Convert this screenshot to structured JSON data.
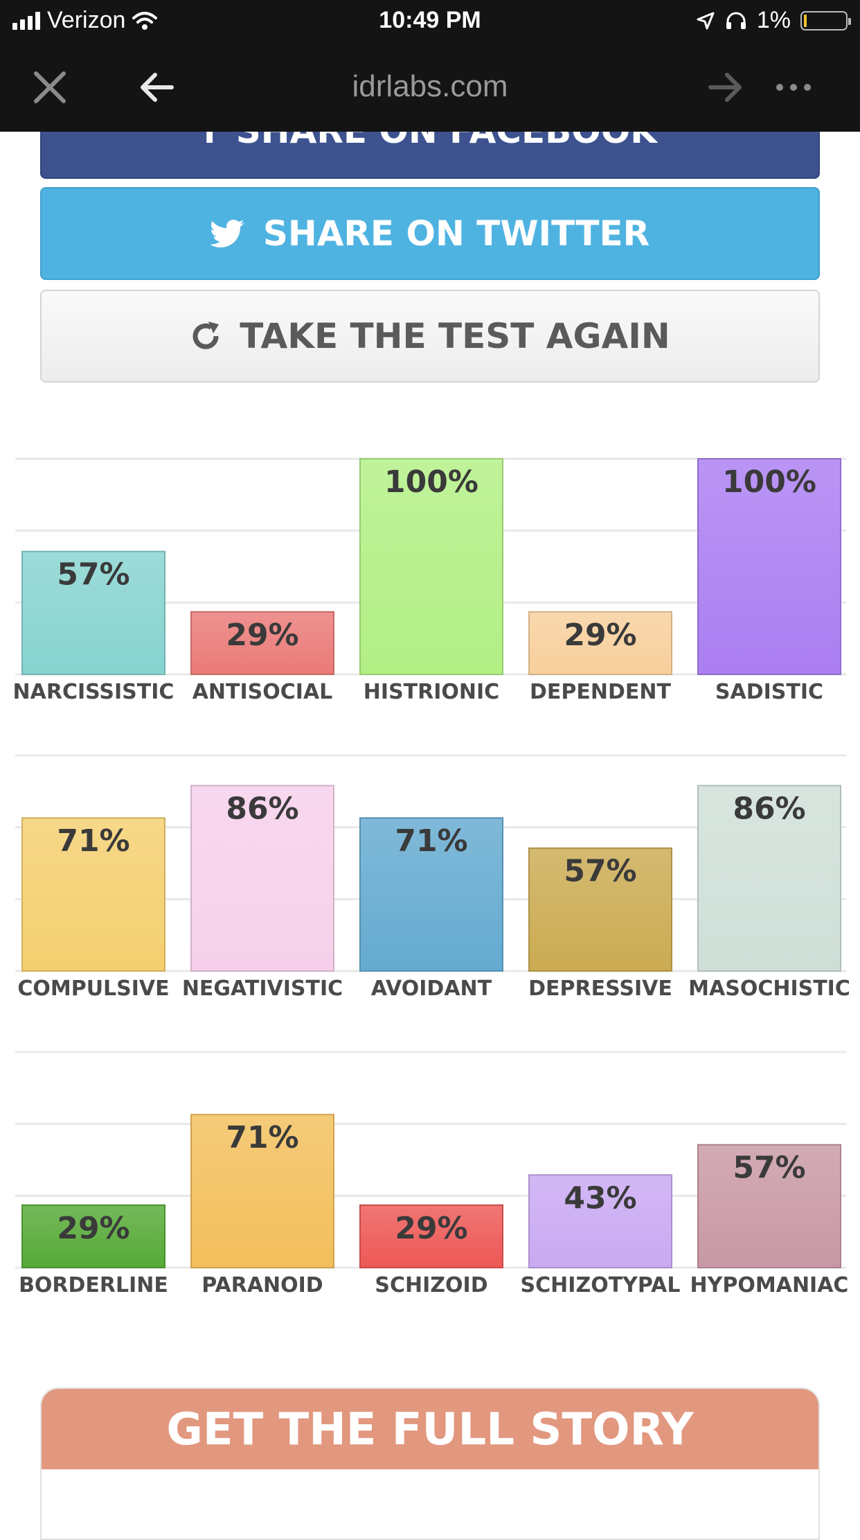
{
  "status_bar": {
    "carrier": "Verizon",
    "time": "10:49 PM",
    "battery": "1%"
  },
  "browser": {
    "url": "idrlabs.com"
  },
  "buttons": {
    "facebook": "SHARE ON FACEBOOK",
    "twitter": "SHARE ON TWITTER",
    "again": "TAKE THE TEST AGAIN"
  },
  "chart_data": [
    {
      "type": "bar",
      "ylim": [
        0,
        100
      ],
      "grid": true,
      "categories": [
        "NARCISSISTIC",
        "ANTISOCIAL",
        "HISTRIONIC",
        "DEPENDENT",
        "SADISTIC"
      ],
      "values": [
        57,
        29,
        100,
        29,
        100
      ],
      "labels": [
        "57%",
        "29%",
        "100%",
        "29%",
        "100%"
      ],
      "colors": [
        "#86d3cf",
        "#ea7a78",
        "#b2ef84",
        "#f8cf9c",
        "#ab7ef1"
      ]
    },
    {
      "type": "bar",
      "ylim": [
        0,
        100
      ],
      "grid": true,
      "categories": [
        "COMPULSIVE",
        "NEGATIVISTIC",
        "AVOIDANT",
        "DEPRESSIVE",
        "MASOCHISTIC"
      ],
      "values": [
        71,
        86,
        71,
        57,
        86
      ],
      "labels": [
        "71%",
        "86%",
        "71%",
        "57%",
        "86%"
      ],
      "colors": [
        "#f4cf6f",
        "#f6d0ea",
        "#64aad0",
        "#cbab52",
        "#cfdfd8"
      ]
    },
    {
      "type": "bar",
      "ylim": [
        0,
        100
      ],
      "grid": true,
      "categories": [
        "BORDERLINE",
        "PARANOID",
        "SCHIZOID",
        "SCHIZOTYPAL",
        "HYPOMANIAC"
      ],
      "values": [
        29,
        71,
        29,
        43,
        57
      ],
      "labels": [
        "29%",
        "71%",
        "29%",
        "43%",
        "57%"
      ],
      "colors": [
        "#56aa36",
        "#f3bf5c",
        "#ed5856",
        "#c9a9f2",
        "#c898a5"
      ]
    }
  ],
  "story": {
    "title": "GET THE FULL STORY"
  }
}
